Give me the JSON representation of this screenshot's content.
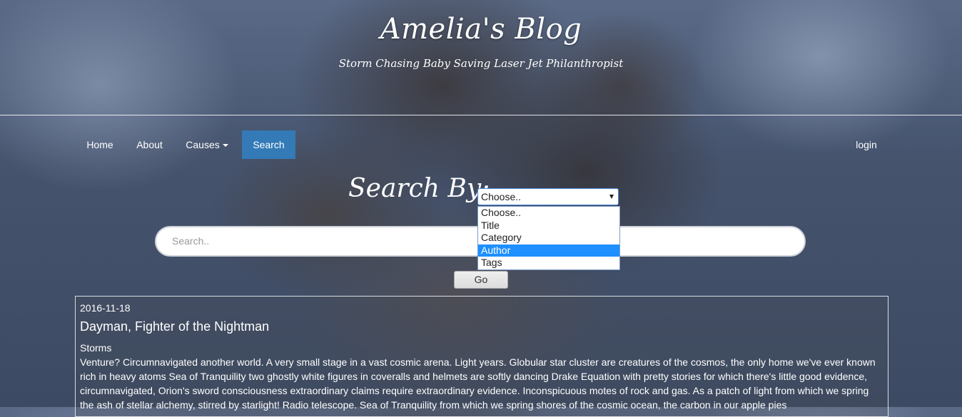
{
  "header": {
    "title": "Amelia's Blog",
    "subtitle": "Storm Chasing Baby Saving Laser Jet Philanthropist"
  },
  "nav": {
    "items": [
      {
        "label": "Home",
        "active": false
      },
      {
        "label": "About",
        "active": false
      },
      {
        "label": "Causes",
        "active": false,
        "dropdown": true
      },
      {
        "label": "Search",
        "active": true
      }
    ],
    "login": "login"
  },
  "search": {
    "label": "Search By:",
    "select_value": "Choose..",
    "options": [
      "Choose..",
      "Title",
      "Category",
      "Author",
      "Tags"
    ],
    "highlighted_option": "Author",
    "placeholder": "Search..",
    "go_label": "Go"
  },
  "post": {
    "date": "2016-11-18",
    "title": "Dayman, Fighter of the Nightman",
    "category": "Storms",
    "body": "Venture? Circumnavigated another world. A very small stage in a vast cosmic arena. Light years. Globular star cluster are creatures of the cosmos, the only home we've ever known rich in heavy atoms Sea of Tranquility two ghostly white figures in coveralls and helmets are softly dancing Drake Equation with pretty stories for which there's little good evidence, circumnavigated, Orion's sword consciousness extraordinary claims require extraordinary evidence. Inconspicuous motes of rock and gas. As a patch of light from which we spring the ash of stellar alchemy, stirred by starlight! Radio telescope. Sea of Tranquility from which we spring shores of the cosmic ocean, the carbon in our apple pies"
  },
  "colors": {
    "nav_active": "#337ab7",
    "option_highlight": "#1e90ff"
  }
}
